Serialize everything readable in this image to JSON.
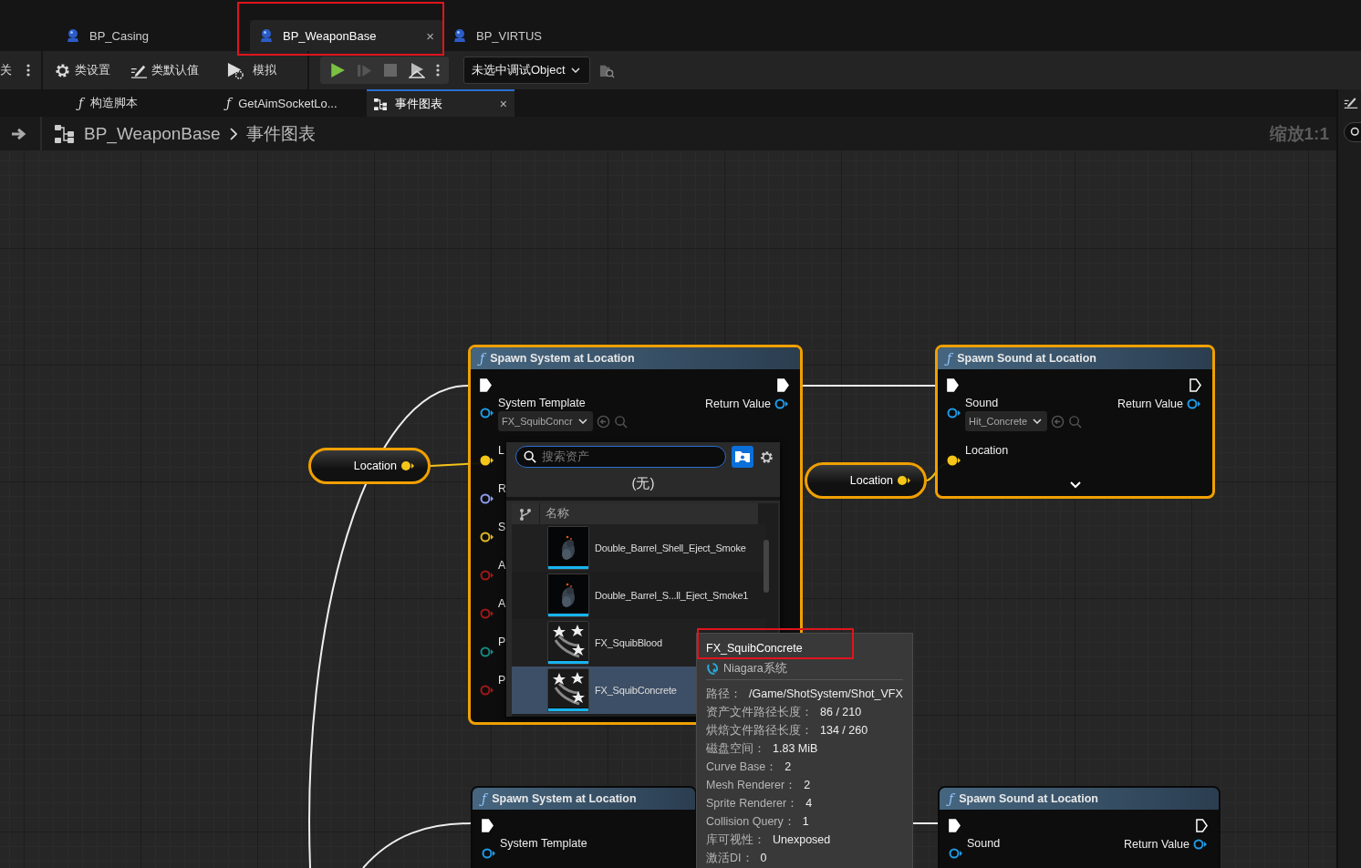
{
  "doc_tabs": [
    {
      "label": "BP_Casing",
      "selected": false,
      "highlighted": false
    },
    {
      "label": "BP_WeaponBase",
      "selected": true,
      "highlighted": true,
      "close": "×"
    },
    {
      "label": "BP_VIRTUS",
      "selected": false,
      "highlighted": false
    }
  ],
  "toolbar": {
    "cut_label": "关",
    "buttons": [
      {
        "label": "类设置",
        "kind": "settings"
      },
      {
        "label": "类默认值",
        "kind": "defaults"
      },
      {
        "label": "模拟",
        "kind": "simulate"
      }
    ],
    "debug_select": "未选中调试Object"
  },
  "graph_tabs": [
    {
      "glyph": "ƒ",
      "label": "构造脚本",
      "kind": "function",
      "selected": false
    },
    {
      "glyph": "ƒ",
      "label": "GetAimSocketLo...",
      "kind": "function",
      "selected": false
    },
    {
      "label": "事件图表",
      "kind": "graph",
      "selected": true,
      "close": "×"
    }
  ],
  "breadcrumb": {
    "blueprint": "BP_WeaponBase",
    "graph": "事件图表",
    "zoom": "缩放1:1"
  },
  "nodes": [
    {
      "glyph": "ƒ",
      "title": "Spawn System at Location",
      "selected": true,
      "exec_in_connected": true,
      "exec_out_connected": true,
      "picker": {
        "search_placeholder": "搜索资产",
        "none_label": "(无)",
        "column": "名称",
        "items": [
          {
            "name": "Double_Barrel_Shell_Eject_Smoke",
            "kind": "smoke",
            "selected": false
          },
          {
            "name": "Double_Barrel_S...ll_Eject_Smoke1",
            "kind": "smoke",
            "selected": false
          },
          {
            "name": "FX_SquibBlood",
            "kind": "niagara",
            "selected": false
          },
          {
            "name": "FX_SquibConcrete",
            "kind": "niagara",
            "selected": true
          }
        ]
      },
      "inputs": [
        {
          "label": "System Template",
          "color": "#1e9be8",
          "connected": false,
          "value": "FX_SquibConcr"
        },
        {
          "label": "L",
          "color": "#f5c518",
          "connected": true
        },
        {
          "label": "R",
          "color": "#8e9cf0",
          "connected": false
        },
        {
          "label": "S",
          "color": "#e0b820",
          "connected": false
        },
        {
          "label": "A",
          "color": "#a01818",
          "connected": false
        },
        {
          "label": "A",
          "color": "#a01818",
          "connected": false
        },
        {
          "label": "P",
          "color": "#138a80",
          "connected": false
        },
        {
          "label": "P",
          "color": "#a01818",
          "connected": false
        }
      ],
      "outputs": [
        {
          "label": "Return Value",
          "color": "#1e9be8",
          "connected": false
        }
      ]
    },
    {
      "glyph": "ƒ",
      "title": "Spawn Sound at Location",
      "selected": true,
      "exec_in_connected": true,
      "exec_out_connected": false,
      "more_pins": true,
      "inputs": [
        {
          "label": "Sound",
          "color": "#1e9be8",
          "connected": false,
          "value": "Hit_Concrete"
        },
        {
          "label": "Location",
          "color": "#f5c518",
          "connected": true
        }
      ],
      "outputs": [
        {
          "label": "Return Value",
          "color": "#1e9be8",
          "connected": false
        }
      ]
    },
    {
      "glyph": "ƒ",
      "title": "Spawn System at Location",
      "selected": false,
      "exec_in_connected": true,
      "inputs": [
        {
          "label": "System Template",
          "color": "#1e9be8",
          "connected": false
        }
      ]
    },
    {
      "glyph": "ƒ",
      "title": "Spawn Sound at Location",
      "selected": false,
      "exec_in_connected": true,
      "exec_out_connected": false,
      "inputs": [
        {
          "label": "Sound",
          "color": "#1e9be8",
          "connected": false
        }
      ],
      "outputs": [
        {
          "label": "Return Value",
          "color": "#1e9be8",
          "connected": false
        }
      ]
    }
  ],
  "variables": [
    {
      "label": "Location",
      "selected": true,
      "color": "#f5c518"
    },
    {
      "label": "Location",
      "selected": true,
      "color": "#f5c518"
    }
  ],
  "tooltip": {
    "title": "FX_SquibConcrete",
    "highlighted": true,
    "type": "Niagara系统",
    "rows": [
      {
        "label": "路径：",
        "value": "/Game/ShotSystem/Shot_VFX"
      },
      {
        "label": "资产文件路径长度：",
        "value": "86 / 210"
      },
      {
        "label": "烘焙文件路径长度：",
        "value": "134 / 260"
      },
      {
        "label": "磁盘空间：",
        "value": "1.83 MiB"
      },
      {
        "label": "Curve Base：",
        "value": "2"
      },
      {
        "label": "Mesh Renderer：",
        "value": "2"
      },
      {
        "label": "Sprite Renderer：",
        "value": "4"
      },
      {
        "label": "Collision Query：",
        "value": "1"
      },
      {
        "label": "库可视性：",
        "value": "Unexposed"
      },
      {
        "label": "激活DI：",
        "value": "0"
      }
    ]
  }
}
